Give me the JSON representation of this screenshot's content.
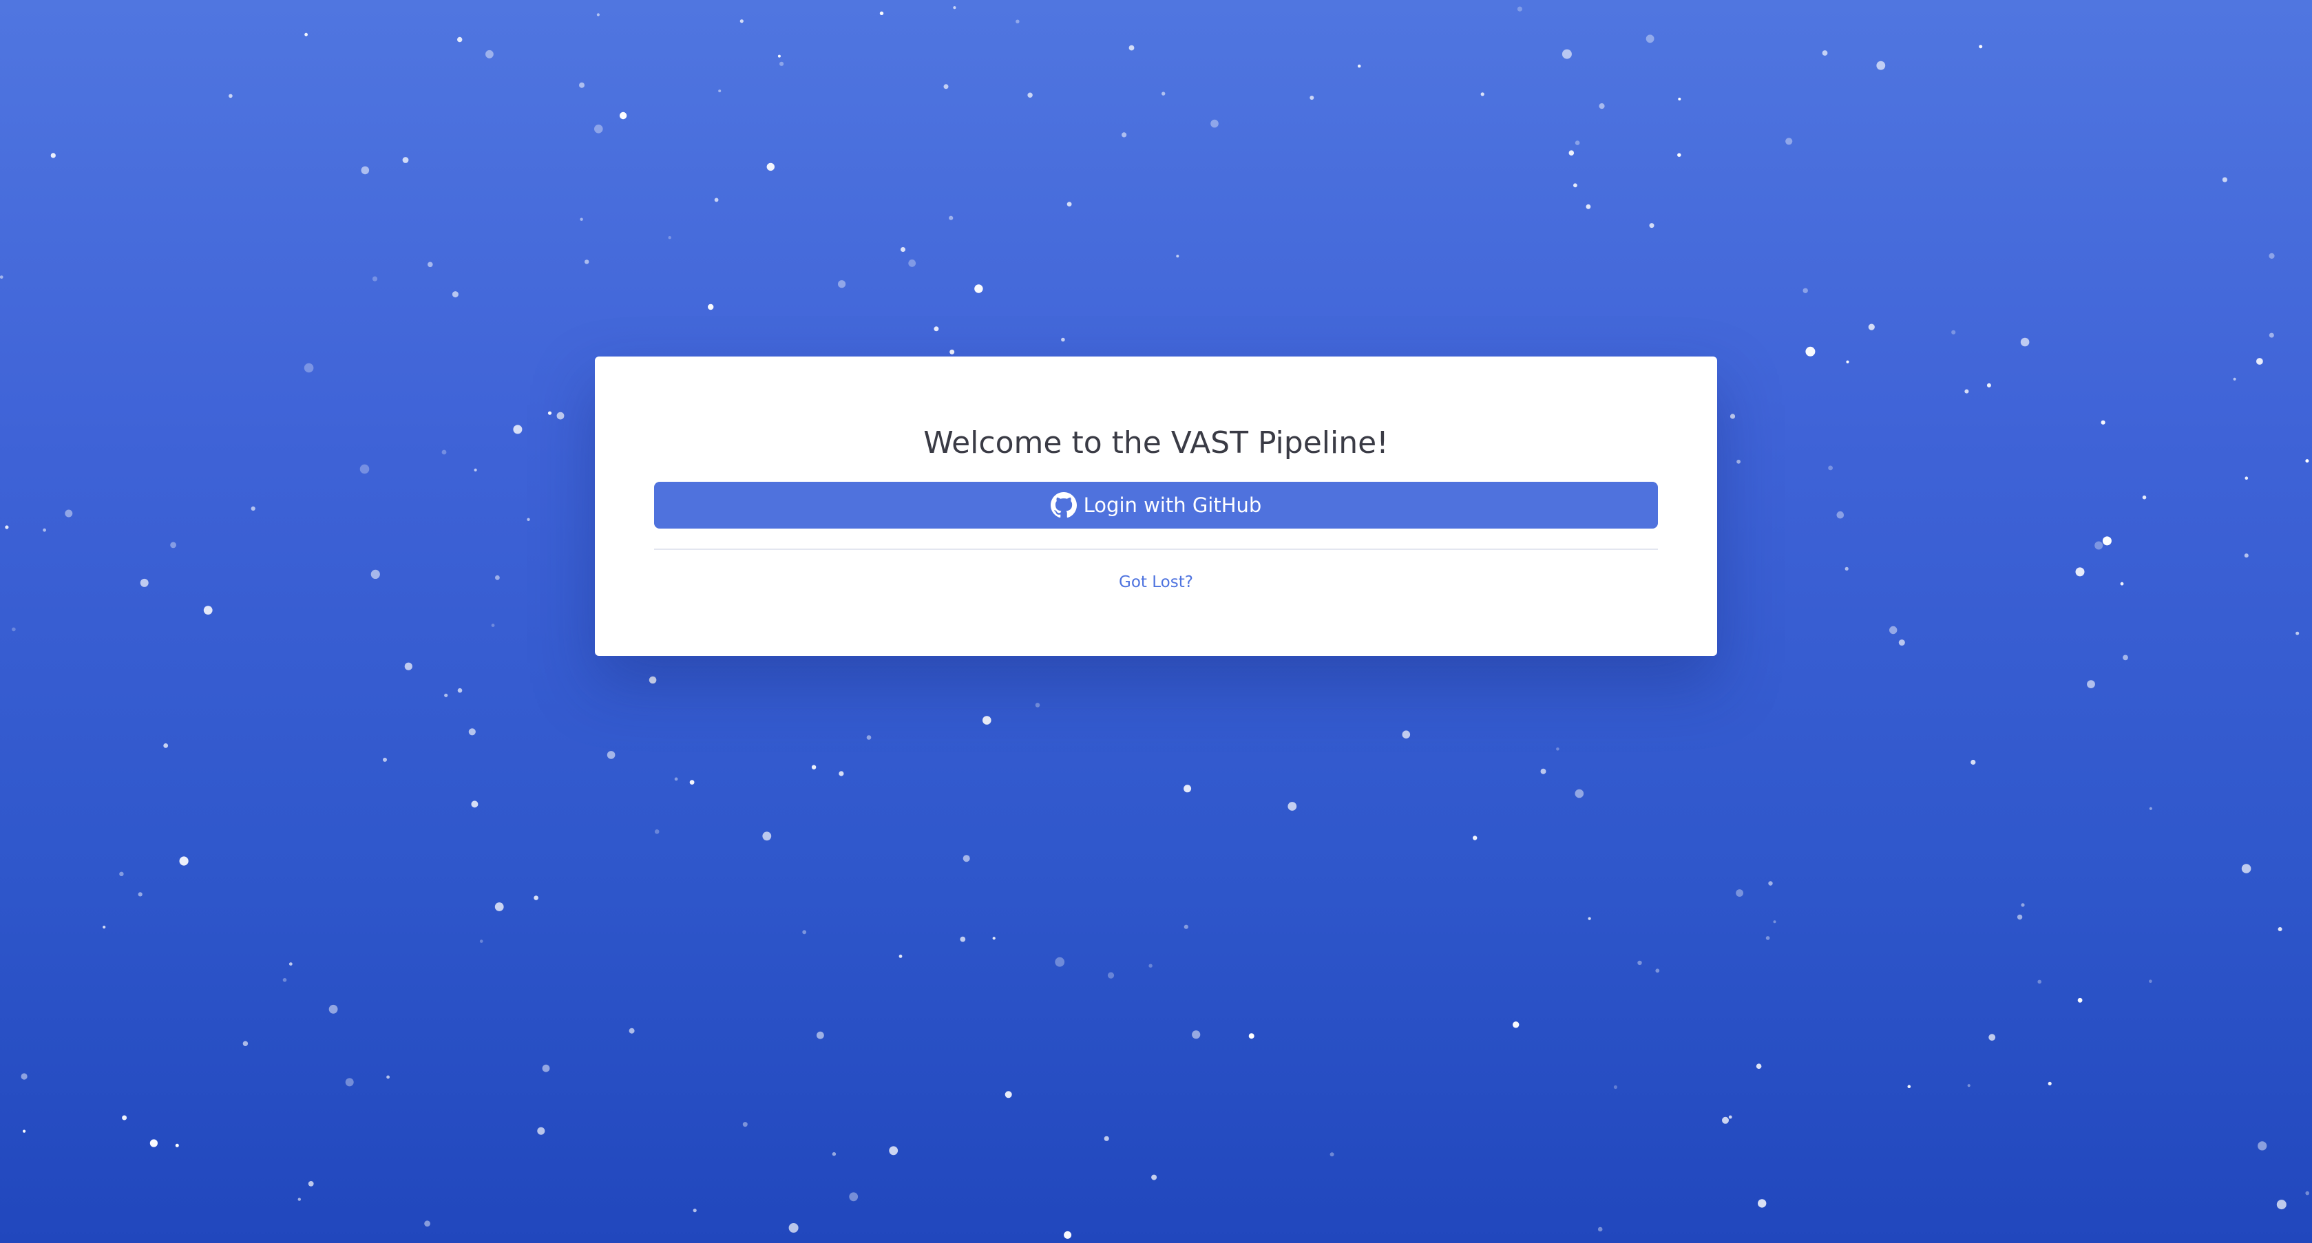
{
  "page": {
    "background_colors": [
      "#5076e0",
      "#2147bd"
    ],
    "star_color": "#ffffff"
  },
  "login": {
    "title": "Welcome to the VAST Pipeline!",
    "github_button_label": "Login with GitHub",
    "github_button_icon": "github-icon",
    "help_link_label": "Got Lost?",
    "accent_color": "#4e73df"
  }
}
